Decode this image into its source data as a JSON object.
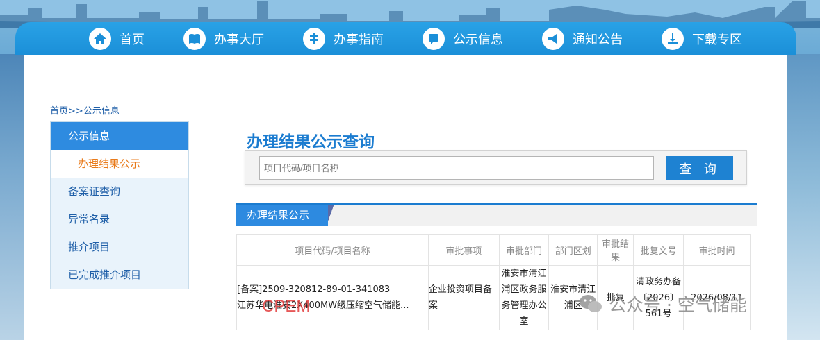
{
  "nav": {
    "items": [
      {
        "label": "首页",
        "icon": "home-icon"
      },
      {
        "label": "办事大厅",
        "icon": "book-icon"
      },
      {
        "label": "办事指南",
        "icon": "signpost-icon"
      },
      {
        "label": "公示信息",
        "icon": "chat-icon"
      },
      {
        "label": "通知公告",
        "icon": "megaphone-icon"
      },
      {
        "label": "下载专区",
        "icon": "download-icon"
      }
    ]
  },
  "breadcrumb": {
    "home": "首页",
    "sep": ">>",
    "current": "公示信息"
  },
  "sidebar": {
    "header": "公示信息",
    "active_sub": "办理结果公示",
    "items": [
      "备案证查询",
      "异常名录",
      "推介项目",
      "已完成推介项目"
    ]
  },
  "main": {
    "title": "办理结果公示查询",
    "search_placeholder": "项目代码/项目名称",
    "search_button": "查 询",
    "section_tab": "办理结果公示"
  },
  "table": {
    "columns": [
      "项目代码/项目名称",
      "审批事项",
      "审批部门",
      "部门区划",
      "审批结果",
      "批复文号",
      "审批时间"
    ],
    "rows": [
      {
        "code": "[备案]2509-320812-89-01-341083",
        "name": "江苏华电淮安2X400MW级压缩空气储能...",
        "item": "企业投资项目备案",
        "dept": "淮安市清江浦区政务服务管理办公室",
        "region": "淮安市清江浦区",
        "result": "批复",
        "doc": "清政务办备〔2026〕561号",
        "time": "2026/08/11"
      }
    ]
  },
  "watermarks": {
    "cpem": "CPEM",
    "wechat": "公众号 · 空气储能"
  },
  "colors": {
    "primary": "#1b8fd8",
    "accent_orange": "#e97b1b",
    "title_blue": "#1b7cd0"
  }
}
